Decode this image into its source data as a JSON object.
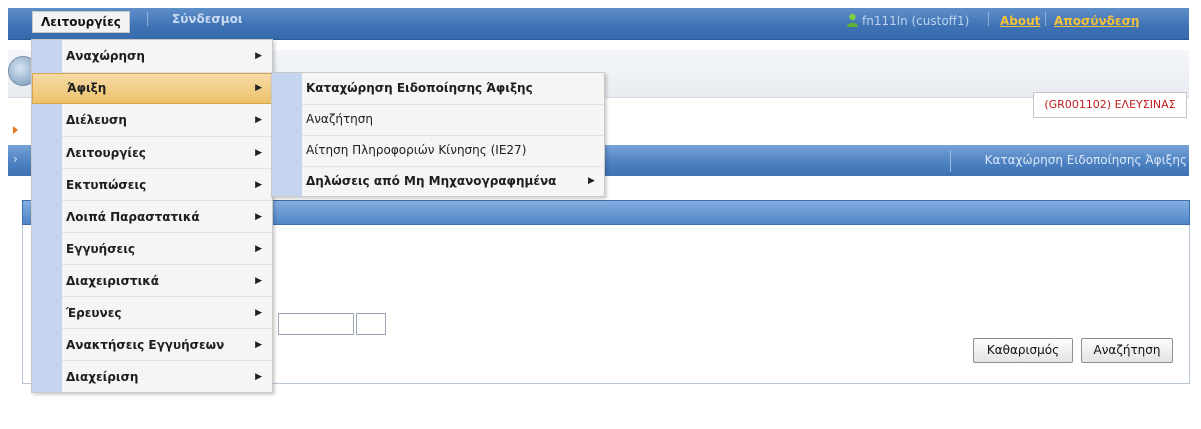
{
  "topbar": {
    "menu_label": "Λειτουργίες",
    "links_label": "Σύνδεσμοι",
    "user_text": "fn111ln (custoff1)",
    "about_label": "About",
    "logout_label": "Αποσύνδεση"
  },
  "office": {
    "text": "(GR001102) ΕΛΕΥΣΙΝΑΣ"
  },
  "breadcrumb": {
    "text": "Καταχώρηση Ειδοποίησης Άφιξης"
  },
  "buttons": {
    "clear_label": "Καθαρισμός",
    "search_label": "Αναζήτηση"
  },
  "main_menu": {
    "items": [
      {
        "label": "Αναχώρηση"
      },
      {
        "label": "Άφιξη"
      },
      {
        "label": "Διέλευση"
      },
      {
        "label": "Λειτουργίες"
      },
      {
        "label": "Εκτυπώσεις"
      },
      {
        "label": "Λοιπά Παραστατικά"
      },
      {
        "label": "Εγγυήσεις"
      },
      {
        "label": "Διαχειριστικά"
      },
      {
        "label": "Έρευνες"
      },
      {
        "label": "Ανακτήσεις Εγγυήσεων"
      },
      {
        "label": "Διαχείριση"
      }
    ],
    "active_index": 1
  },
  "submenu": {
    "items": [
      {
        "label": "Καταχώρηση Ειδοποίησης Άφιξης"
      },
      {
        "label": "Αναζήτηση"
      },
      {
        "label": "Αίτηση Πληροφοριών Κίνησης (IE27)"
      },
      {
        "label": "Δηλώσεις από Μη Μηχανογραφημένα"
      }
    ]
  },
  "colors": {
    "menu_highlight": "#edc26b",
    "office_text": "#c31c1c",
    "link": "#f6c13b",
    "titlebar": "#4a7fc0"
  }
}
